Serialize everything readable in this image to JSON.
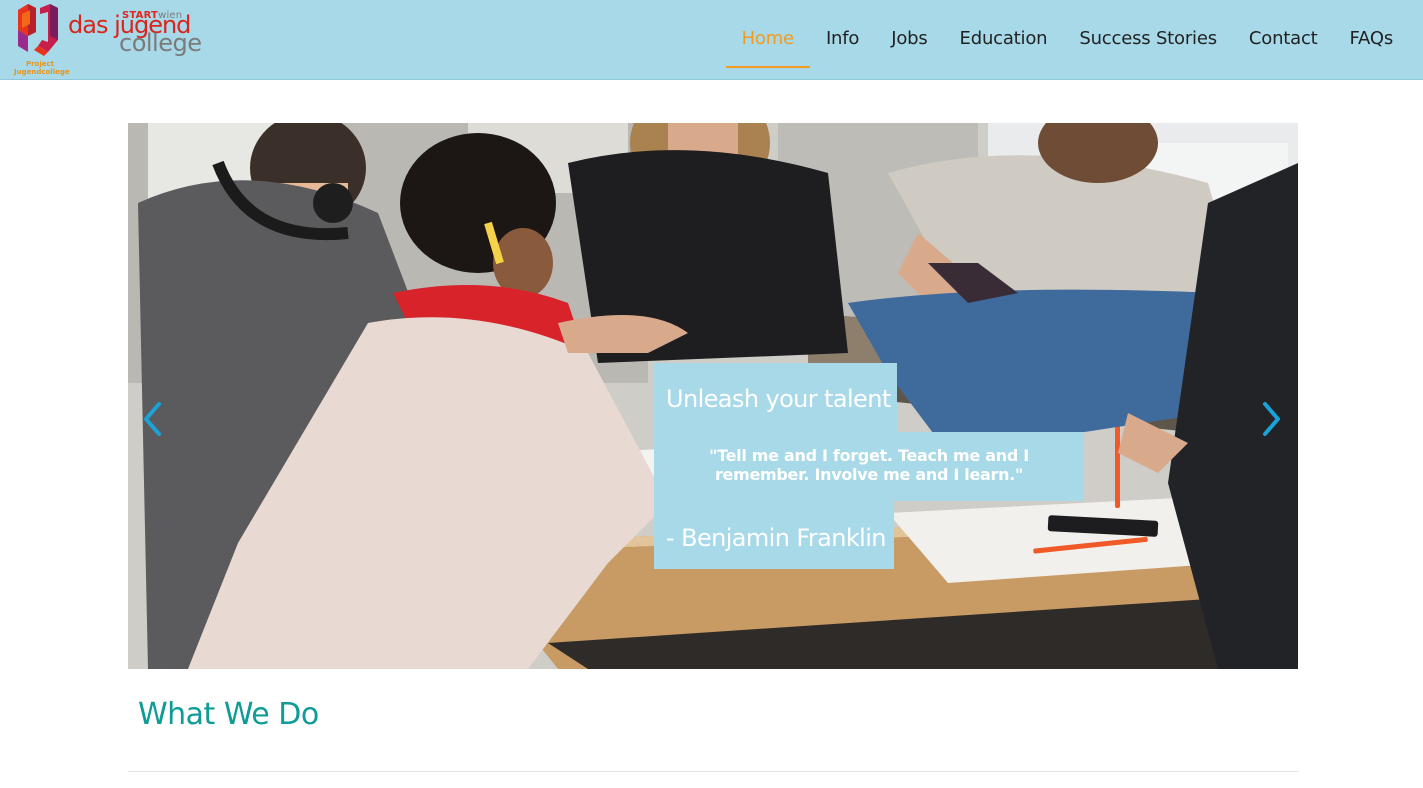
{
  "logo": {
    "start_prefix": "START",
    "start_suffix": "wien",
    "line1": "das jugend",
    "line2": "college",
    "sub": "Project Jugendcollege"
  },
  "nav": {
    "items": [
      {
        "label": "Home",
        "active": true
      },
      {
        "label": "Info"
      },
      {
        "label": "Jobs"
      },
      {
        "label": "Education"
      },
      {
        "label": "Success Stories"
      },
      {
        "label": "Contact"
      },
      {
        "label": "FAQs"
      }
    ]
  },
  "carousel": {
    "caption_title": "Unleash your talent",
    "caption_quote": "\"Tell me and I forget. Teach me and I remember. Involve me and I learn.\"",
    "caption_author": "- Benjamin Franklin",
    "prev_icon": "chevron-left-icon",
    "next_icon": "chevron-right-icon"
  },
  "main": {
    "section_title": "What We Do"
  },
  "colors": {
    "navbar_bg": "#a7d9e9",
    "nav_active": "#f39a1f",
    "heading_teal": "#0f9c96",
    "arrow_blue": "#1aa3d6"
  }
}
